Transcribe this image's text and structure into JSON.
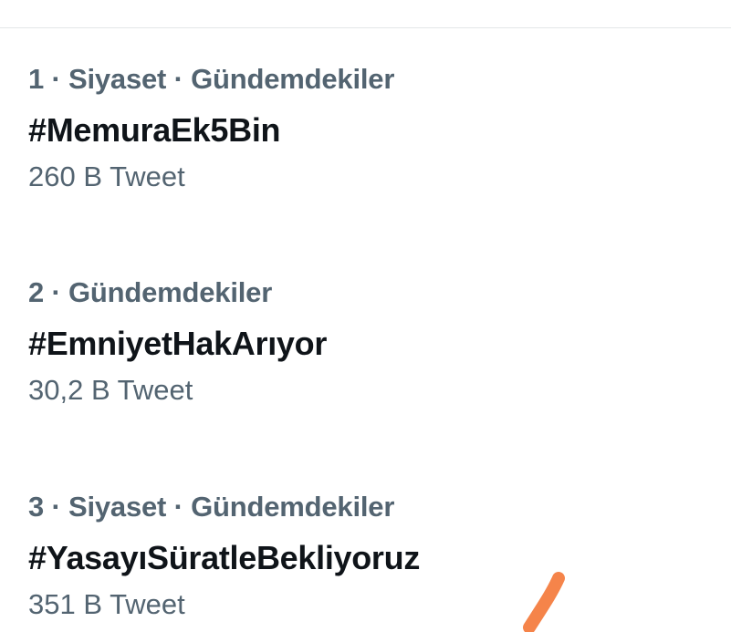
{
  "trends": [
    {
      "meta": "1 · Siyaset · Gündemdekiler",
      "title": "#MemuraEk5Bin",
      "count": "260 B Tweet"
    },
    {
      "meta": "2 · Gündemdekiler",
      "title": "#EmniyetHakArıyor",
      "count": "30,2 B Tweet"
    },
    {
      "meta": "3 · Siyaset · Gündemdekiler",
      "title": "#YasayıSüratleBekliyoruz",
      "count": "351 B Tweet"
    }
  ],
  "colors": {
    "meta_text": "#536471",
    "title_text": "#0f1419",
    "divider": "#e3e6e8",
    "annotation_stroke": "#f5844a"
  },
  "icons": {
    "annotation": "hand-drawn-arrow-stroke"
  }
}
